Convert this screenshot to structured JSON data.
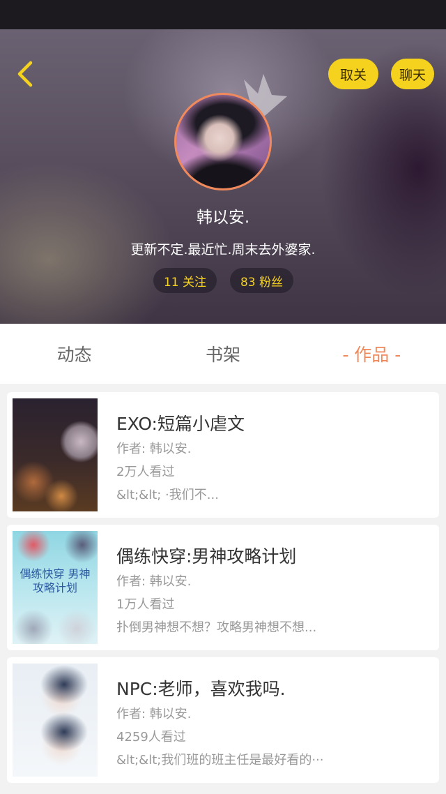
{
  "profile": {
    "name": "韩以安.",
    "bio": "更新不定.最近忙.周末去外婆家.",
    "following": "11 关注",
    "followers": "83 粉丝"
  },
  "header": {
    "back_icon": "chevron-left-icon",
    "unfollow_label": "取关",
    "chat_label": "聊天",
    "accent_color": "#f5d21e"
  },
  "tabs": [
    {
      "label": "动态",
      "active": false
    },
    {
      "label": "书架",
      "active": false
    },
    {
      "label": "- 作品 -",
      "active": true
    }
  ],
  "works": [
    {
      "title": "EXO:短篇小虐文",
      "author": "作者: 韩以安.",
      "views": "2万人看过",
      "desc": "&lt;&lt; ·我们不..."
    },
    {
      "title": "偶练快穿:男神攻略计划",
      "author": "作者: 韩以安.",
      "views": "1万人看过",
      "desc": "扑倒男神想不想？攻略男神想不想...",
      "cover_text": "偶练快穿 男神攻略计划"
    },
    {
      "title": "NPC:老师，喜欢我吗.",
      "author": "作者: 韩以安.",
      "views": "4259人看过",
      "desc": "&lt;&lt;我们班的班主任是最好看的···"
    }
  ]
}
